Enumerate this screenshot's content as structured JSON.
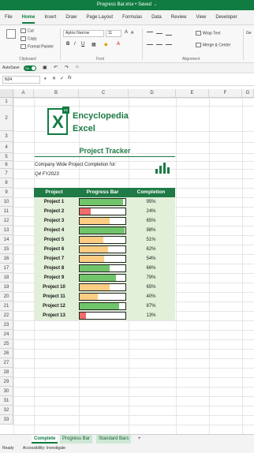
{
  "titlebar": {
    "title": "Progress Bar.xlsx • Saved",
    "chevron": "⌄"
  },
  "tabs": [
    "File",
    "Home",
    "Insert",
    "Draw",
    "Page Layout",
    "Formulas",
    "Data",
    "Review",
    "View",
    "Developer"
  ],
  "ribbon": {
    "cut": "Cut",
    "copy": "Copy",
    "format_painter": "Format Painter",
    "clipboard_group": "Clipboard",
    "font_name": "Aptos Narrow",
    "font_size": "11",
    "font_group": "Font",
    "wrap_text": "Wrap Text",
    "merge_center": "Merge & Center",
    "alignment_group": "Alignment",
    "general": "Ge"
  },
  "autosave": {
    "label": "AutoSave",
    "state": "On"
  },
  "formula_bar": {
    "name_box": "N24",
    "fx": "fx"
  },
  "columns": [
    "A",
    "B",
    "C",
    "D",
    "E",
    "F",
    "G"
  ],
  "rows": [
    "1",
    "2",
    "3",
    "4",
    "5",
    "6",
    "7",
    "8",
    "9",
    "10",
    "11",
    "12",
    "13",
    "14",
    "15",
    "16",
    "17",
    "18",
    "19",
    "20",
    "21",
    "22",
    "23",
    "24",
    "25",
    "26",
    "27",
    "28",
    "29",
    "30",
    "31",
    "32",
    "33"
  ],
  "logo": {
    "letter": "X",
    "badge": "EE",
    "line1": "Encyclopedia",
    "line2": "Excel"
  },
  "tracker": {
    "title": "Project Tracker",
    "company_text": "Company Wide Project Completion for:",
    "period": "Q4 FY2023",
    "headers": [
      "Project",
      "Progress Bar",
      "Completion"
    ],
    "projects": [
      {
        "name": "Project 1",
        "pct": 95,
        "label": "95%",
        "color": "#70c46a"
      },
      {
        "name": "Project 2",
        "pct": 24,
        "label": "24%",
        "color": "#f06b6b"
      },
      {
        "name": "Project 3",
        "pct": 65,
        "label": "65%",
        "color": "#fdcd84"
      },
      {
        "name": "Project 4",
        "pct": 98,
        "label": "98%",
        "color": "#70c46a"
      },
      {
        "name": "Project 5",
        "pct": 51,
        "label": "51%",
        "color": "#fdcd84"
      },
      {
        "name": "Project 6",
        "pct": 62,
        "label": "62%",
        "color": "#fdcd84"
      },
      {
        "name": "Project 7",
        "pct": 54,
        "label": "54%",
        "color": "#fdcd84"
      },
      {
        "name": "Project 8",
        "pct": 66,
        "label": "66%",
        "color": "#70c46a"
      },
      {
        "name": "Project 9",
        "pct": 79,
        "label": "79%",
        "color": "#70c46a"
      },
      {
        "name": "Project 10",
        "pct": 65,
        "label": "65%",
        "color": "#fdcd84"
      },
      {
        "name": "Project 11",
        "pct": 40,
        "label": "40%",
        "color": "#fdcd84"
      },
      {
        "name": "Project 12",
        "pct": 87,
        "label": "87%",
        "color": "#70c46a"
      },
      {
        "name": "Project 13",
        "pct": 13,
        "label": "13%",
        "color": "#f06b6b"
      }
    ]
  },
  "sheet_tabs": [
    "Complete",
    "Progress Bar",
    "Standard Bars"
  ],
  "status": {
    "ready": "Ready",
    "accessibility": "Accessibility: Investigate"
  },
  "colors": {
    "excel_green": "#107c41",
    "header_green": "#1f7a45",
    "row_fill": "#e2f0d9"
  }
}
